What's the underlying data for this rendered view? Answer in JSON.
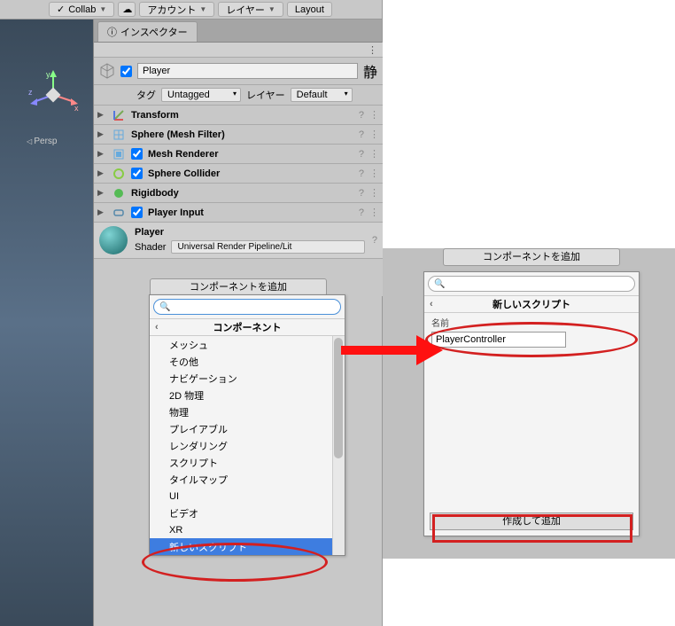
{
  "toolbar": {
    "collab": "Collab",
    "account": "アカウント",
    "layers": "レイヤー",
    "layout": "Layout"
  },
  "inspector": {
    "tab": "インスペクター",
    "header_btn": "⋮",
    "object_name": "Player",
    "static_label": "静",
    "tag_label": "タグ",
    "tag_value": "Untagged",
    "layer_label": "レイヤー",
    "layer_value": "Default"
  },
  "components": [
    {
      "name": "Transform",
      "checkbox": false
    },
    {
      "name": "Sphere (Mesh Filter)",
      "checkbox": false
    },
    {
      "name": "Mesh Renderer",
      "checkbox": true
    },
    {
      "name": "Sphere Collider",
      "checkbox": true
    },
    {
      "name": "Rigidbody",
      "checkbox": false
    },
    {
      "name": "Player Input",
      "checkbox": true
    }
  ],
  "material": {
    "name": "Player",
    "shader_label": "Shader",
    "shader_value": "Universal Render Pipeline/Lit"
  },
  "add_component": "コンポーネントを追加",
  "dropdown_left": {
    "header": "コンポーネント",
    "items": [
      "メッシュ",
      "その他",
      "ナビゲーション",
      "2D 物理",
      "物理",
      "プレイアブル",
      "レンダリング",
      "スクリプト",
      "タイルマップ",
      "UI",
      "ビデオ",
      "XR",
      "新しいスクリプト"
    ]
  },
  "persp": "Persp",
  "dropdown_right": {
    "header": "新しいスクリプト",
    "name_label": "名前",
    "name_value": "PlayerController",
    "create": "作成して追加"
  },
  "icons": {
    "check": "✓",
    "cloud": "☁"
  }
}
